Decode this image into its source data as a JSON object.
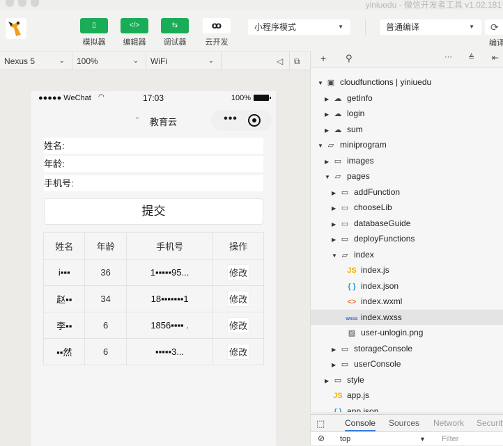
{
  "window": {
    "title": "yiniuedu - 微信开发者工具 v1.02.181"
  },
  "toolbar": {
    "buttons": [
      {
        "label": "模拟器",
        "icon": "phone-icon",
        "glyph": "▯"
      },
      {
        "label": "编辑器",
        "icon": "code-icon",
        "glyph": "</>"
      },
      {
        "label": "调试器",
        "icon": "debug-icon",
        "glyph": "⇆"
      },
      {
        "label": "云开发",
        "icon": "cloud-link-icon",
        "glyph": "ꝏ"
      }
    ],
    "mode_select": "小程序模式",
    "compile_select": "普通编译",
    "compile_label": "编译",
    "compile_icon": "refresh-icon"
  },
  "simulator_bar": {
    "device": "Nexus 5",
    "zoom": "100%",
    "network": "WiFi"
  },
  "phone": {
    "status": {
      "carrier": "●●●●● WeChat",
      "time": "17:03",
      "battery": "100%"
    },
    "nav_title": "教育云",
    "form": {
      "name_label": "姓名:",
      "age_label": "年龄:",
      "phone_label": "手机号:",
      "submit_label": "提交"
    },
    "table": {
      "headers": [
        "姓名",
        "年龄",
        "手机号",
        "操作"
      ],
      "rows": [
        {
          "name": "i▪▪▪",
          "age": "36",
          "phone": "1▪▪▪▪▪95...",
          "action": "修改"
        },
        {
          "name": "赵▪▪",
          "age": "34",
          "phone": "18▪▪▪▪▪▪▪1",
          "action": "修改"
        },
        {
          "name": "李▪▪",
          "age": "6",
          "phone": "1856▪▪▪▪ .",
          "action": "修改"
        },
        {
          "name": "▪▪然",
          "age": "6",
          "phone": "▪▪▪▪▪3...",
          "action": "修改"
        }
      ]
    }
  },
  "explorer": {
    "tree": [
      {
        "label": "cloudfunctions | yiniuedu",
        "depth": 0,
        "state": "open",
        "icon": "cloud-folder-icon"
      },
      {
        "label": "getInfo",
        "depth": 1,
        "state": "closed",
        "icon": "cloud-icon"
      },
      {
        "label": "login",
        "depth": 1,
        "state": "closed",
        "icon": "cloud-icon"
      },
      {
        "label": "sum",
        "depth": 1,
        "state": "closed",
        "icon": "cloud-icon"
      },
      {
        "label": "miniprogram",
        "depth": 0,
        "state": "open",
        "icon": "folder-open-icon"
      },
      {
        "label": "images",
        "depth": 1,
        "state": "closed",
        "icon": "folder-icon"
      },
      {
        "label": "pages",
        "depth": 1,
        "state": "open",
        "icon": "folder-open-icon"
      },
      {
        "label": "addFunction",
        "depth": 2,
        "state": "closed",
        "icon": "folder-icon"
      },
      {
        "label": "chooseLib",
        "depth": 2,
        "state": "closed",
        "icon": "folder-icon"
      },
      {
        "label": "databaseGuide",
        "depth": 2,
        "state": "closed",
        "icon": "folder-icon"
      },
      {
        "label": "deployFunctions",
        "depth": 2,
        "state": "closed",
        "icon": "folder-icon"
      },
      {
        "label": "index",
        "depth": 2,
        "state": "open",
        "icon": "folder-open-icon"
      },
      {
        "label": "index.js",
        "depth": 3,
        "state": "file",
        "icon": "js-file-icon"
      },
      {
        "label": "index.json",
        "depth": 3,
        "state": "file",
        "icon": "json-file-icon"
      },
      {
        "label": "index.wxml",
        "depth": 3,
        "state": "file",
        "icon": "wxml-file-icon"
      },
      {
        "label": "index.wxss",
        "depth": 3,
        "state": "file",
        "icon": "wxss-file-icon",
        "selected": true
      },
      {
        "label": "user-unlogin.png",
        "depth": 3,
        "state": "file",
        "icon": "image-file-icon"
      },
      {
        "label": "storageConsole",
        "depth": 2,
        "state": "closed",
        "icon": "folder-icon"
      },
      {
        "label": "userConsole",
        "depth": 2,
        "state": "closed",
        "icon": "folder-icon"
      },
      {
        "label": "style",
        "depth": 1,
        "state": "closed",
        "icon": "folder-icon"
      },
      {
        "label": "app.js",
        "depth": 1,
        "state": "file",
        "icon": "js-file-icon"
      },
      {
        "label": "app.json",
        "depth": 1,
        "state": "file",
        "icon": "json-file-icon"
      }
    ]
  },
  "devtools": {
    "tabs": [
      "Console",
      "Sources",
      "Network",
      "Security"
    ],
    "active_tab": "Console",
    "context": "top",
    "filter_placeholder": "Filter"
  }
}
